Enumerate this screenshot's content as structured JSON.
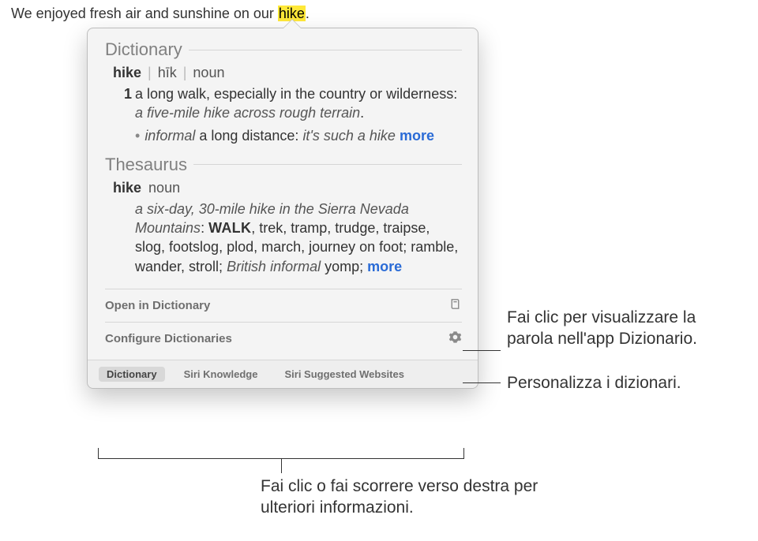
{
  "sentence": {
    "prefix": "We enjoyed fresh air and sunshine on our ",
    "highlight": "hike",
    "suffix": "."
  },
  "dictionary": {
    "section_title": "Dictionary",
    "headword": "hike",
    "pronunciation": "hīk",
    "part_of_speech": "noun",
    "def_number": "1",
    "def_main": "a long walk, especially in the country or wilderness: ",
    "def_example": "a five-mile hike across rough terrain",
    "def_period": ".",
    "sub_label": "informal",
    "sub_def": " a long distance: ",
    "sub_example": "it's such a hike",
    "more": "more"
  },
  "thesaurus": {
    "section_title": "Thesaurus",
    "headword": "hike",
    "part_of_speech": "noun",
    "example": "a six-day, 30-mile hike in the Sierra Nevada Mountains",
    "colon": ": ",
    "primary_caps": "WALK",
    "synonyms_rest": ", trek, tramp, trudge, traipse, slog, footslog, plod, march, journey on foot; ramble, wander, stroll; ",
    "british_label": "British informal",
    "british_syn": " yomp; ",
    "more": "more"
  },
  "actions": {
    "open_in_dictionary": "Open in Dictionary",
    "configure_dictionaries": "Configure Dictionaries"
  },
  "tabs": {
    "dictionary": "Dictionary",
    "siri_knowledge": "Siri Knowledge",
    "siri_websites": "Siri Suggested Websites"
  },
  "callouts": {
    "open_dict": "Fai clic per visualizzare la parola nell'app Dizionario.",
    "configure": "Personalizza i dizionari.",
    "bottom": "Fai clic o fai scorrere verso destra per ulteriori informazioni."
  }
}
